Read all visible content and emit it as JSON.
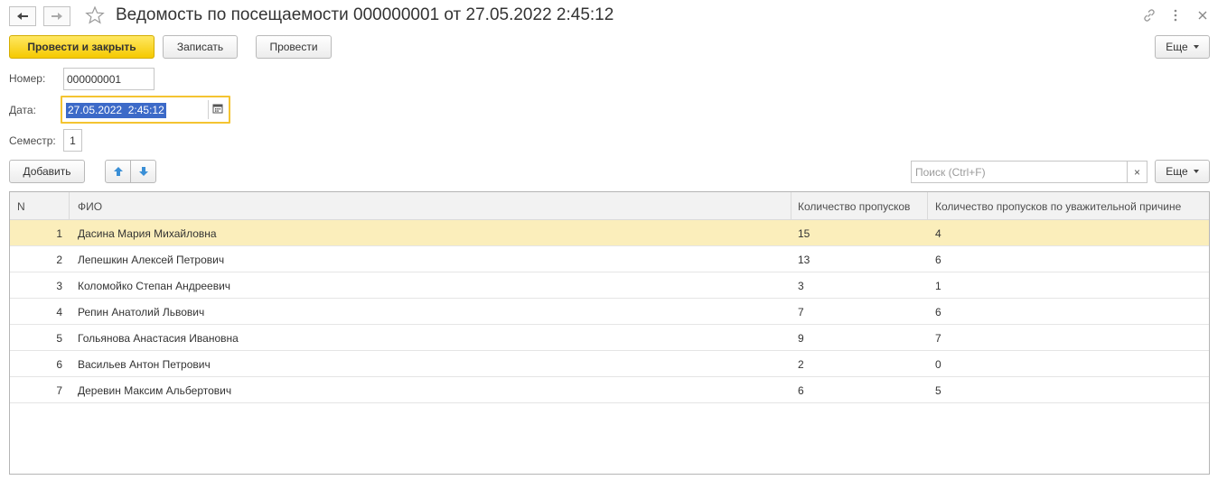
{
  "window": {
    "title": "Ведомость по посещаемости 000000001 от 27.05.2022 2:45:12"
  },
  "toolbar": {
    "post_and_close": "Провести и закрыть",
    "save": "Записать",
    "post": "Провести",
    "more": "Еще"
  },
  "form": {
    "number_label": "Номер:",
    "number_value": "000000001",
    "date_label": "Дата:",
    "date_value": "27.05.2022  2:45:12",
    "semester_label": "Семестр:",
    "semester_value": "1"
  },
  "table_toolbar": {
    "add": "Добавить",
    "search_placeholder": "Поиск (Ctrl+F)",
    "clear": "×",
    "more": "Еще"
  },
  "table": {
    "columns": [
      "N",
      "ФИО",
      "Количество пропусков",
      "Количество пропусков по уважительной причине"
    ],
    "rows": [
      {
        "n": "1",
        "fio": "Дасина Мария Михайловна",
        "absences": "15",
        "excused": "4"
      },
      {
        "n": "2",
        "fio": "Лепешкин Алексей Петрович",
        "absences": "13",
        "excused": "6"
      },
      {
        "n": "3",
        "fio": "Коломойко Степан Андреевич",
        "absences": "3",
        "excused": "1"
      },
      {
        "n": "4",
        "fio": "Репин Анатолий Львович",
        "absences": "7",
        "excused": "6"
      },
      {
        "n": "5",
        "fio": "Гольянова Анастасия Ивановна",
        "absences": "9",
        "excused": "7"
      },
      {
        "n": "6",
        "fio": "Васильев Антон Петрович",
        "absences": "2",
        "excused": "0"
      },
      {
        "n": "7",
        "fio": "Деревин Максим Альбертович",
        "absences": "6",
        "excused": "5"
      }
    ],
    "selected_row": 0
  },
  "colors": {
    "primary_button": "#f5c900",
    "selected_row": "#fbeebb",
    "focus_border": "#f4c431",
    "selection": "#3c6ac8"
  },
  "icons": [
    "back-arrow-icon",
    "forward-arrow-icon",
    "favorite-star-icon",
    "link-icon",
    "more-vertical-icon",
    "close-icon",
    "calendar-icon",
    "move-up-icon",
    "move-down-icon"
  ]
}
